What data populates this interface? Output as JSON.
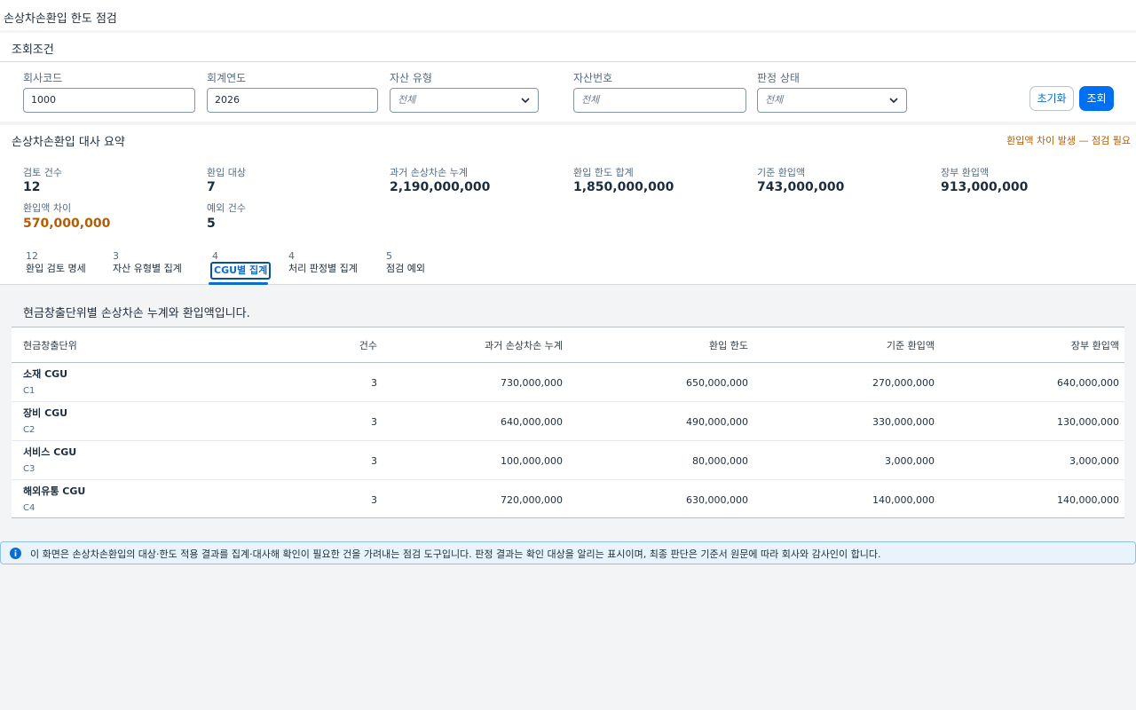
{
  "page": {
    "title": "손상차손환입 한도 점검"
  },
  "filters": {
    "section_title": "조회조건",
    "fields": [
      {
        "label": "회사코드",
        "value": "1000"
      },
      {
        "label": "회계연도",
        "value": "2026"
      },
      {
        "label": "자산 유형",
        "placeholder": "전체"
      },
      {
        "label": "자산번호",
        "placeholder": "전체"
      },
      {
        "label": "판정 상태",
        "placeholder": "전체"
      }
    ],
    "reset_label": "초기화",
    "search_label": "조회"
  },
  "summary": {
    "title": "손상차손환입 대사 요약",
    "alert": "환입액 차이 발생 — 점검 필요",
    "kpis": [
      {
        "label": "검토 건수",
        "value": "12"
      },
      {
        "label": "환입 대상",
        "value": "7"
      },
      {
        "label": "과거 손상차손 누계",
        "value": "2,190,000,000"
      },
      {
        "label": "환입 한도 합계",
        "value": "1,850,000,000"
      },
      {
        "label": "기준 환입액",
        "value": "743,000,000"
      },
      {
        "label": "장부 환입액",
        "value": "913,000,000"
      },
      {
        "label": "환입액 차이",
        "value": "570,000,000"
      },
      {
        "label": "예외 건수",
        "value": "5"
      }
    ]
  },
  "tabs": [
    {
      "count": "12",
      "label": "환입 검토 명세"
    },
    {
      "count": "3",
      "label": "자산 유형별 집계"
    },
    {
      "count": "4",
      "label": "CGU별 집계"
    },
    {
      "count": "4",
      "label": "처리 판정별 집계"
    },
    {
      "count": "5",
      "label": "점검 예외"
    }
  ],
  "table": {
    "caption": "현금창출단위별 손상차손 누계와 환입액입니다.",
    "headers": [
      "현금창출단위",
      "건수",
      "과거 손상차손 누계",
      "환입 한도",
      "기준 환입액",
      "장부 환입액"
    ],
    "rows": [
      {
        "name": "소재 CGU",
        "code": "C1",
        "count": "3",
        "impairment": "730,000,000",
        "limit": "650,000,000",
        "base": "270,000,000",
        "book": "640,000,000"
      },
      {
        "name": "장비 CGU",
        "code": "C2",
        "count": "3",
        "impairment": "640,000,000",
        "limit": "490,000,000",
        "base": "330,000,000",
        "book": "130,000,000"
      },
      {
        "name": "서비스 CGU",
        "code": "C3",
        "count": "3",
        "impairment": "100,000,000",
        "limit": "80,000,000",
        "base": "3,000,000",
        "book": "3,000,000"
      },
      {
        "name": "해외유통 CGU",
        "code": "C4",
        "count": "3",
        "impairment": "720,000,000",
        "limit": "630,000,000",
        "base": "140,000,000",
        "book": "140,000,000"
      }
    ]
  },
  "info": {
    "icon": "info-icon",
    "text": "이 화면은 손상차손환입의 대상·한도 적용 결과를 집계·대사해 확인이 필요한 건을 가려내는 점검 도구입니다. 판정 결과는 확인 대상을 알리는 표시이며, 최종 판단은 기준서 원문에 따라 회사와 감사인이 합니다."
  },
  "colors": {
    "accent": "#0070f2",
    "warning": "#b35c00",
    "info_bg": "#e8f3fb"
  }
}
